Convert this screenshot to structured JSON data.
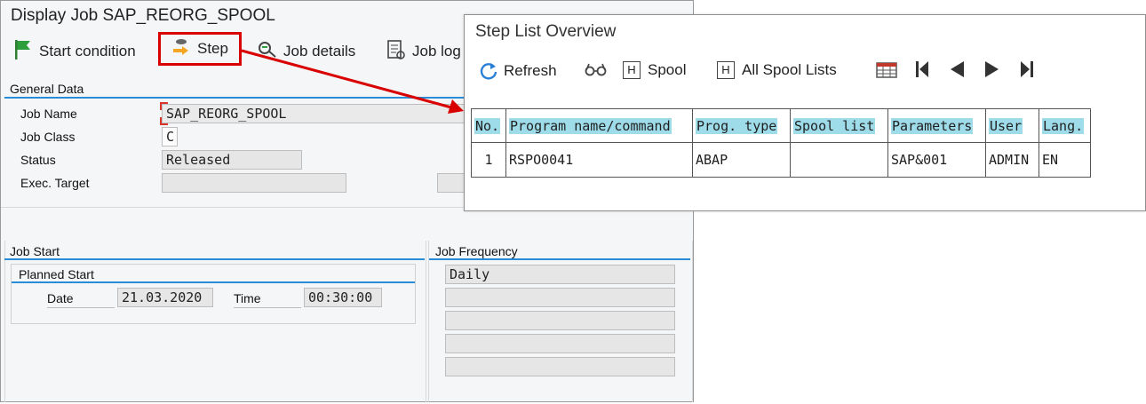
{
  "main": {
    "title": "Display Job SAP_REORG_SPOOL",
    "toolbar": {
      "start_condition": "Start condition",
      "step": "Step",
      "job_details": "Job details",
      "job_log": "Job log"
    },
    "general_data": {
      "section_label": "General Data",
      "job_name_label": "Job Name",
      "job_name_value": "SAP_REORG_SPOOL",
      "job_class_label": "Job Class",
      "job_class_value": "C",
      "status_label": "Status",
      "status_value": "Released",
      "exec_target_label": "Exec. Target",
      "exec_target_value": ""
    },
    "job_start": {
      "section_label": "Job Start",
      "planned_start_label": "Planned Start",
      "date_label": "Date",
      "date_value": "21.03.2020",
      "time_label": "Time",
      "time_value": "00:30:00"
    },
    "job_frequency": {
      "section_label": "Job Frequency",
      "values": [
        "Daily",
        "",
        "",
        "",
        ""
      ]
    }
  },
  "overlay": {
    "title": "Step List Overview",
    "toolbar": {
      "refresh": "Refresh",
      "spool": "Spool",
      "all_spool_lists": "All Spool Lists"
    },
    "table": {
      "headers": [
        "No.",
        "Program name/command",
        "Prog. type",
        "Spool list",
        "Parameters",
        "User",
        "Lang."
      ],
      "rows": [
        [
          "1",
          "RSPO0041",
          "ABAP",
          "",
          "SAP&001",
          "ADMIN",
          "EN"
        ]
      ]
    }
  },
  "colors": {
    "highlight_red": "#d90000",
    "section_blue": "#2a8bd6",
    "header_cyan": "#9edcea"
  }
}
